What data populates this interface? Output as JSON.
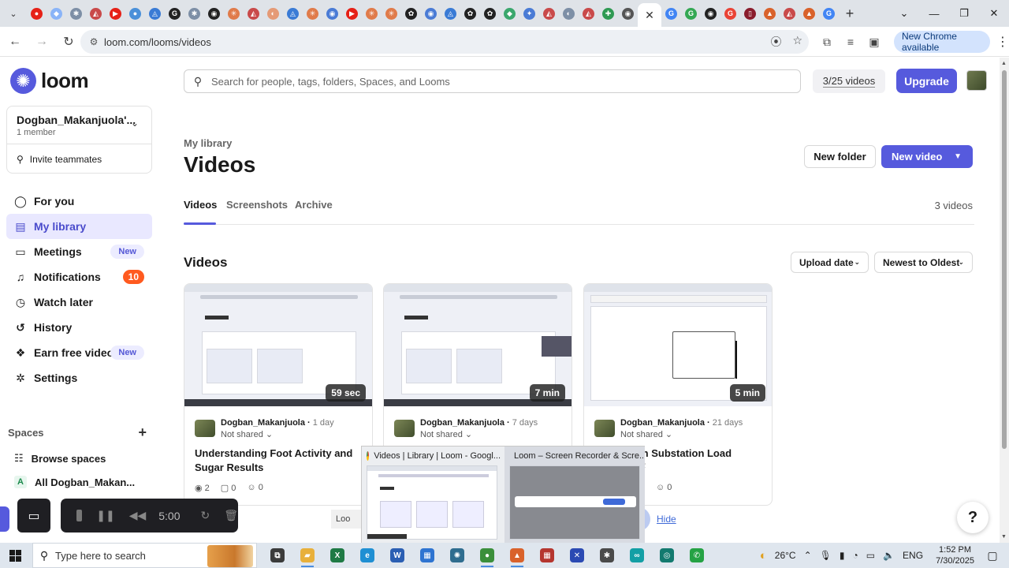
{
  "browser": {
    "url": "loom.com/looms/videos",
    "new_chrome_label": "New Chrome available",
    "tab_favicons": [
      {
        "icon": "youtube-icon",
        "color": "#e62117",
        "glyph": "●"
      },
      {
        "icon": "drive-icon",
        "color": "#8ab4f8",
        "glyph": "◆"
      },
      {
        "icon": "settings-icon",
        "color": "#7d8fa6",
        "glyph": "✱"
      },
      {
        "icon": "app-icon",
        "color": "#c94a4a",
        "glyph": "◭"
      },
      {
        "icon": "youtube-icon",
        "color": "#e62117",
        "glyph": "▶"
      },
      {
        "icon": "chrome-icon",
        "color": "#4a90d9",
        "glyph": "●"
      },
      {
        "icon": "app-icon",
        "color": "#3a7bd5",
        "glyph": "◬"
      },
      {
        "icon": "grammarly-icon",
        "color": "#222222",
        "glyph": "G"
      },
      {
        "icon": "settings-icon",
        "color": "#7d8fa6",
        "glyph": "✱"
      },
      {
        "icon": "github-icon",
        "color": "#222222",
        "glyph": "◉"
      },
      {
        "icon": "asterisk-icon",
        "color": "#e07b4a",
        "glyph": "✳"
      },
      {
        "icon": "app-icon",
        "color": "#c94a4a",
        "glyph": "◭"
      },
      {
        "icon": "app-icon",
        "color": "#e59a76",
        "glyph": "◐"
      },
      {
        "icon": "app-icon",
        "color": "#3a7bd5",
        "glyph": "◬"
      },
      {
        "icon": "asterisk-icon",
        "color": "#e07b4a",
        "glyph": "✳"
      },
      {
        "icon": "app-icon",
        "color": "#4a7bd5",
        "glyph": "◉"
      },
      {
        "icon": "youtube-icon",
        "color": "#e62117",
        "glyph": "▶"
      },
      {
        "icon": "asterisk-icon",
        "color": "#e07b4a",
        "glyph": "✳"
      },
      {
        "icon": "asterisk-icon",
        "color": "#e07b4a",
        "glyph": "✳"
      },
      {
        "icon": "openai-icon",
        "color": "#222222",
        "glyph": "✿"
      },
      {
        "icon": "app-icon",
        "color": "#4a7bd5",
        "glyph": "◉"
      },
      {
        "icon": "app-icon",
        "color": "#3a7bd5",
        "glyph": "◬"
      },
      {
        "icon": "openai-icon",
        "color": "#222222",
        "glyph": "✿"
      },
      {
        "icon": "openai-icon",
        "color": "#222222",
        "glyph": "✿"
      },
      {
        "icon": "app-icon",
        "color": "#3aa76d",
        "glyph": "◆"
      },
      {
        "icon": "gemini-icon",
        "color": "#4a7bd5",
        "glyph": "✦"
      },
      {
        "icon": "app-icon",
        "color": "#c94a4a",
        "glyph": "◭"
      },
      {
        "icon": "app-icon",
        "color": "#7d8fa6",
        "glyph": "◐"
      },
      {
        "icon": "app-icon",
        "color": "#c94a4a",
        "glyph": "◭"
      },
      {
        "icon": "app-icon",
        "color": "#2f9a53",
        "glyph": "✚"
      },
      {
        "icon": "app-icon",
        "color": "#555555",
        "glyph": "◉"
      }
    ],
    "tab_favicons_after": [
      {
        "icon": "google-icon",
        "color": "#4285f4",
        "glyph": "G"
      },
      {
        "icon": "google-icon",
        "color": "#34a853",
        "glyph": "G"
      },
      {
        "icon": "app-icon",
        "color": "#222222",
        "glyph": "◉"
      },
      {
        "icon": "google-icon",
        "color": "#ea4335",
        "glyph": "G"
      },
      {
        "icon": "app-icon",
        "color": "#8a1c2c",
        "glyph": "▯"
      },
      {
        "icon": "matlab-icon",
        "color": "#d9622b",
        "glyph": "▲"
      },
      {
        "icon": "app-icon",
        "color": "#c94a4a",
        "glyph": "◭"
      },
      {
        "icon": "matlab-icon",
        "color": "#d9622b",
        "glyph": "▲"
      },
      {
        "icon": "google-icon",
        "color": "#4285f4",
        "glyph": "G"
      }
    ]
  },
  "sidebar": {
    "logo_text": "loom",
    "workspace_name": "Dogban_Makanjuola'...",
    "workspace_members": "1 member",
    "invite_label": "Invite teammates",
    "nav": [
      {
        "label": "For you",
        "icon": "person-circle-icon",
        "glyph": "◯"
      },
      {
        "label": "My library",
        "icon": "library-icon",
        "glyph": "▤",
        "active": true
      },
      {
        "label": "Meetings",
        "icon": "meetings-icon",
        "glyph": "▭",
        "badge": "New"
      },
      {
        "label": "Notifications",
        "icon": "bell-icon",
        "glyph": "♫",
        "count": "10"
      },
      {
        "label": "Watch later",
        "icon": "clock-icon",
        "glyph": "◷"
      },
      {
        "label": "History",
        "icon": "history-icon",
        "glyph": "↺"
      },
      {
        "label": "Earn free videos",
        "icon": "gift-icon",
        "glyph": "❖",
        "badge": "New"
      },
      {
        "label": "Settings",
        "icon": "gear-icon",
        "glyph": "✲"
      }
    ],
    "spaces_heading": "Spaces",
    "browse_spaces": "Browse spaces",
    "all_space": "All Dogban_Makan...",
    "all_space_letter": "A"
  },
  "header": {
    "search_placeholder": "Search for people, tags, folders, Spaces, and Looms",
    "video_quota": "3/25 videos",
    "upgrade_label": "Upgrade"
  },
  "page": {
    "breadcrumb": "My library",
    "title": "Videos",
    "new_folder_label": "New folder",
    "new_video_label": "New video",
    "tabs": [
      "Videos",
      "Screenshots",
      "Archive"
    ],
    "video_count": "3 videos",
    "section_title": "Videos",
    "filter_label": "Upload date",
    "sort_label": "Newest to Oldest"
  },
  "videos": [
    {
      "duration": "59 sec",
      "author": "Dogban_Makanjuola",
      "age": "1 day",
      "sharing": "Not shared",
      "title": "Understanding Foot Activity and Sugar Results",
      "views": "2",
      "comments": "0",
      "reactions": "0"
    },
    {
      "duration": "7 min",
      "author": "Dogban_Makanjuola",
      "age": "7 days",
      "sharing": "Not shared",
      "title": "",
      "views": "",
      "comments": "",
      "reactions": ""
    },
    {
      "duration": "5 min",
      "author": "Dogban_Makanjuola",
      "age": "21 days",
      "sharing": "Not shared",
      "title": "of the Main Substation Load Analysis ⚡",
      "views": "",
      "comments": "",
      "reactions": "0"
    }
  ],
  "recorder": {
    "timer": "5:00"
  },
  "popup": {
    "thumb1_title": "Videos | Library | Loom - Googl...",
    "thumb2_title": "Loom – Screen Recorder & Scre...",
    "hide_label": "Hide",
    "partial_label": "Loo"
  },
  "taskbar": {
    "search_placeholder": "Type here to search",
    "weather": "26°C",
    "language": "ENG",
    "time": "1:52 PM",
    "date": "7/30/2025",
    "apps": [
      {
        "icon": "task-view-icon",
        "color": "#3b3b3b",
        "glyph": "⧉"
      },
      {
        "icon": "file-explorer-icon",
        "color": "#e8b03b",
        "glyph": "▰",
        "open": true
      },
      {
        "icon": "excel-icon",
        "color": "#1f7a45",
        "glyph": "X"
      },
      {
        "icon": "edge-icon",
        "color": "#1f8fd3",
        "glyph": "e"
      },
      {
        "icon": "word-icon",
        "color": "#2b5fb3",
        "glyph": "W"
      },
      {
        "icon": "store-icon",
        "color": "#2e74d1",
        "glyph": "▦"
      },
      {
        "icon": "app-icon",
        "color": "#2f6d8f",
        "glyph": "✺"
      },
      {
        "icon": "chrome-icon",
        "color": "#3b8f3b",
        "glyph": "●",
        "open": true
      },
      {
        "icon": "matlab-icon",
        "color": "#d9622b",
        "glyph": "▲",
        "open": true
      },
      {
        "icon": "app-icon",
        "color": "#b5362f",
        "glyph": "▦"
      },
      {
        "icon": "app-icon",
        "color": "#2b4ab3",
        "glyph": "✕"
      },
      {
        "icon": "app-icon",
        "color": "#4a4a4a",
        "glyph": "✱"
      },
      {
        "icon": "arduino-icon",
        "color": "#139fa5",
        "glyph": "∞"
      },
      {
        "icon": "app-icon",
        "color": "#137a6f",
        "glyph": "◎"
      },
      {
        "icon": "whatsapp-icon",
        "color": "#25a244",
        "glyph": "✆"
      }
    ]
  },
  "colors": {
    "brand": "#565add",
    "notification_badge": "#ff5a1f"
  }
}
